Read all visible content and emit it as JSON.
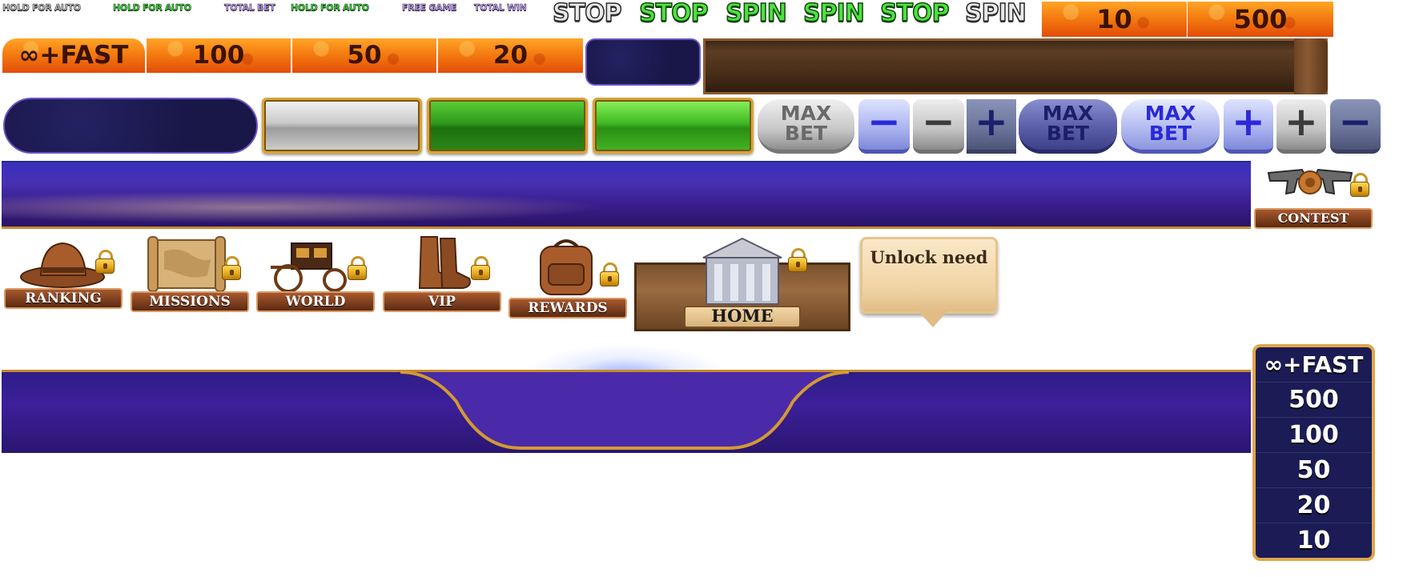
{
  "row1_labels": [
    "HOLD FOR AUTO",
    "HOLD FOR AUTO",
    "TOTAL BET",
    "HOLD FOR AUTO",
    "FREE GAME",
    "TOTAL WIN"
  ],
  "row1_words": [
    "STOP",
    "STOP",
    "SPIN",
    "SPIN",
    "STOP",
    "SPIN"
  ],
  "top_tiles": [
    "10",
    "500"
  ],
  "speed_tiles": [
    "∞+FAST",
    "100",
    "50",
    "20"
  ],
  "bet_buttons": {
    "max_bet_gray": [
      "MAX",
      "BET"
    ],
    "minus": "−",
    "plus": "+",
    "max_bet_navy": [
      "MAX",
      "BET"
    ],
    "max_bet_light": [
      "MAX",
      "BET"
    ]
  },
  "contest": {
    "label": "CONTEST"
  },
  "features": [
    {
      "label": "RANKING"
    },
    {
      "label": "MISSIONS"
    },
    {
      "label": "WORLD"
    },
    {
      "label": "VIP"
    },
    {
      "label": "REWARDS"
    },
    {
      "label": "HOME"
    }
  ],
  "bubble": {
    "text": "Unlock need"
  },
  "speed_list": [
    "∞+FAST",
    "500",
    "100",
    "50",
    "20",
    "10"
  ],
  "colors": {
    "orange": "#f47a10",
    "navy": "#191648",
    "purple": "#3a1e8e",
    "gold": "#d6a437",
    "green": "#3fba23"
  }
}
